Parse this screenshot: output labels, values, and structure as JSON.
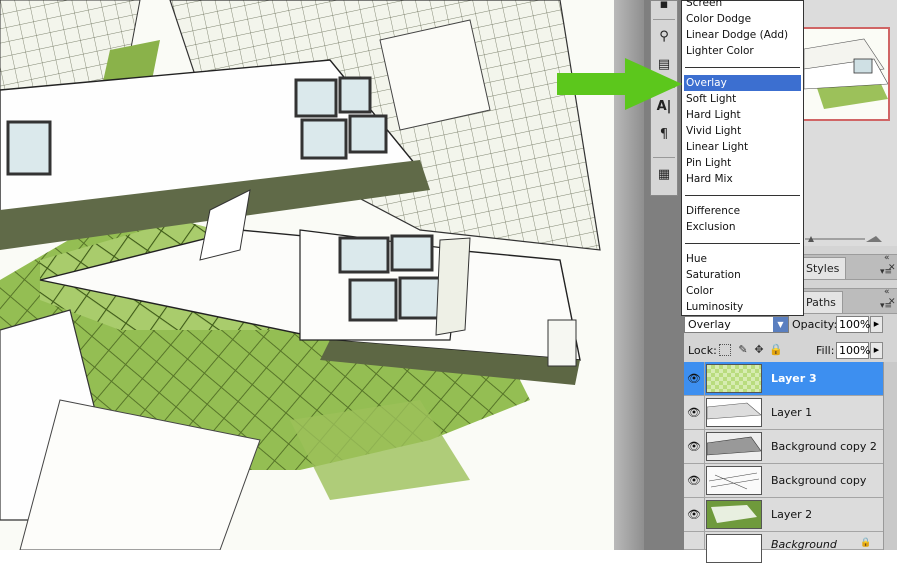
{
  "blend_menu": {
    "groups": [
      [
        {
          "label": "Screen"
        },
        {
          "label": "Color Dodge"
        },
        {
          "label": "Linear Dodge (Add)"
        },
        {
          "label": "Lighter Color"
        }
      ],
      [
        {
          "label": "Overlay"
        },
        {
          "label": "Soft Light"
        },
        {
          "label": "Hard Light"
        },
        {
          "label": "Vivid Light"
        },
        {
          "label": "Linear Light"
        },
        {
          "label": "Pin Light"
        },
        {
          "label": "Hard Mix"
        }
      ],
      [
        {
          "label": "Difference"
        },
        {
          "label": "Exclusion"
        }
      ],
      [
        {
          "label": "Hue"
        },
        {
          "label": "Saturation"
        },
        {
          "label": "Color"
        },
        {
          "label": "Luminosity"
        }
      ]
    ],
    "highlighted": "Overlay"
  },
  "panels": {
    "styles_tab": "Styles",
    "paths_tab": "Paths"
  },
  "layer_controls": {
    "blend_mode": "Overlay",
    "opacity_label": "Opacity:",
    "opacity_value": "100%",
    "lock_label": "Lock:",
    "fill_label": "Fill:",
    "fill_value": "100%"
  },
  "layers": [
    {
      "name": "Layer 3",
      "selected": true
    },
    {
      "name": "Layer 1",
      "selected": false
    },
    {
      "name": "Background copy 2",
      "selected": false
    },
    {
      "name": "Background copy",
      "selected": false
    },
    {
      "name": "Layer 2",
      "selected": false
    },
    {
      "name": "Background",
      "selected": false
    }
  ],
  "icons": {
    "eye": "eye-icon",
    "arrow": "green-arrow-annotation",
    "lock": "lock-icon",
    "move": "move-icon",
    "brush": "brush-icon",
    "transparency": "transparency-lock-icon"
  },
  "colors": {
    "selection": "#3d8ff0",
    "menu_highlight": "#3c6fd0",
    "arrow_green": "#5cc71c",
    "navigator_frame": "#d06565",
    "shadow_green": "#7fae3a"
  }
}
